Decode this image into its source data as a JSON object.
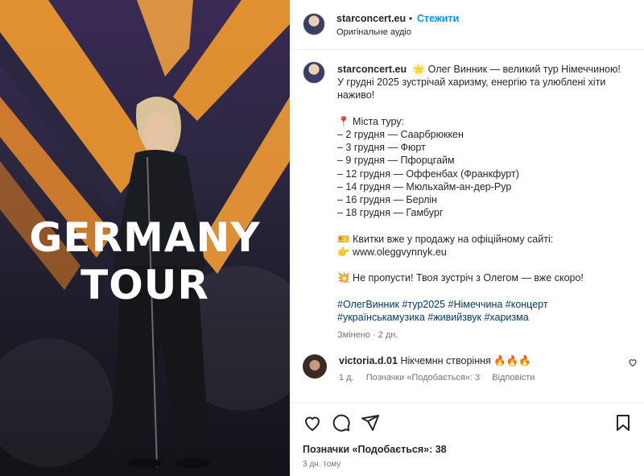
{
  "media": {
    "overlay_line1": "GERMANY",
    "overlay_line2": "TOUR",
    "accent": "#f5a623"
  },
  "header": {
    "username": "starconcert.eu",
    "separator": "•",
    "follow_label": "Стежити",
    "audio_label": "Оригінальне аудіо"
  },
  "caption": {
    "username": "starconcert.eu",
    "lines": [
      "🌟 Олег Винник — великий тур Німеччиною!",
      "У грудні 2025 зустрічай харизму, енергію та улюблені хіти",
      "наживо!",
      "",
      "📍 Міста туру:",
      "– 2 грудня — Саарбрюккен",
      "– 3 грудня — Фюрт",
      "– 9 грудня — Пфорцгайм",
      "– 12 грудня — Оффенбах (Франкфурт)",
      "– 14 грудня — Мюльхайм-ан-дер-Рур",
      "– 16 грудня — Берлін",
      "– 18 грудня — Гамбург",
      "",
      "🎫 Квитки вже у продажу на офіційному сайті:",
      "👉 www.oleggvynnyk.eu",
      "",
      "💥 Не пропусти! Твоя зустріч з Олегом — вже скоро!",
      ""
    ],
    "hashtags_line1": "#ОлегВинник #тур2025 #Німеччина #концерт",
    "hashtags_line2": "#українськамузика #живийзвук #харизма",
    "edited": "Змінено · 2 дн."
  },
  "comment": {
    "username": "victoria.d.01",
    "text": "Нікчемнн створіння 🔥🔥🔥",
    "age": "1 д.",
    "likes": "Позначки «Подобається»: 3",
    "reply_label": "Відповісти"
  },
  "actions": {
    "likes_text": "Позначки «Подобається»: 38",
    "posted_ago": "3 дн. тому"
  }
}
